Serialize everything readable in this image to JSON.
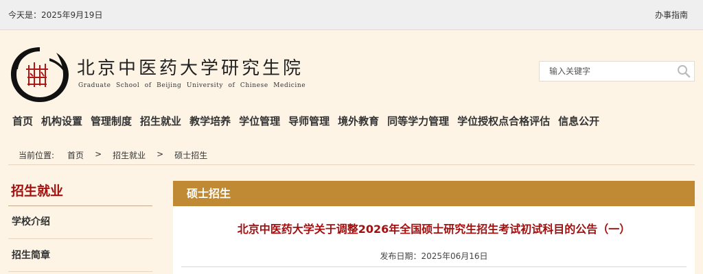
{
  "topbar": {
    "date_text": "今天是：2025年9月19日",
    "guide_link": "办事指南"
  },
  "header": {
    "logo_title": "北京中医药大学研究生院",
    "logo_subtitle": "Graduate School of Beijing University of Chinese Medicine",
    "logo_icon": "school-seal-icon"
  },
  "search": {
    "placeholder": "输入关键字",
    "icon": "search-icon"
  },
  "nav": {
    "items": [
      "首页",
      "机构设置",
      "管理制度",
      "招生就业",
      "教学培养",
      "学位管理",
      "导师管理",
      "境外教育",
      "同等学力管理",
      "学位授权点合格评估",
      "信息公开"
    ]
  },
  "breadcrumb": {
    "label": "当前位置:",
    "items": [
      "首页",
      "招生就业",
      "硕士招生"
    ],
    "separator": ">"
  },
  "sidebar": {
    "title": "招生就业",
    "items": [
      "学校介绍",
      "招生简章"
    ]
  },
  "content": {
    "section_title": "硕士招生",
    "article_title": "北京中医药大学关于调整2026年全国硕士研究生招生考试初试科目的公告（一）",
    "article_date": "发布日期：2025年06月16日"
  },
  "colors": {
    "accent": "#c08a35",
    "title_red": "#a10f0f",
    "background": "#fdf4e6"
  }
}
